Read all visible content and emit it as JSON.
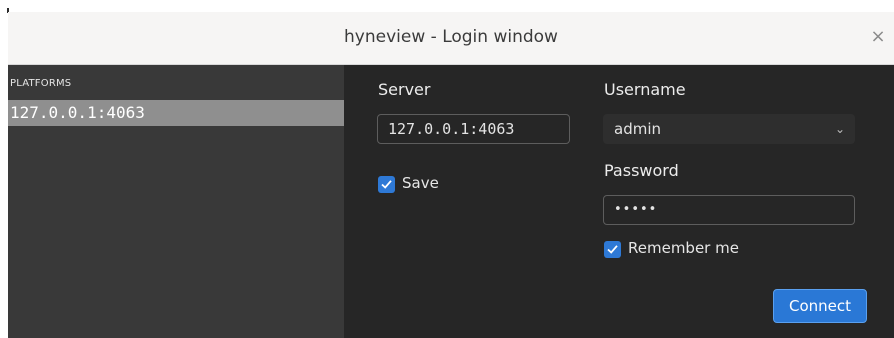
{
  "window": {
    "title": "hyneview - Login window",
    "close_glyph": "×"
  },
  "sidebar": {
    "header": "PLATFORMS",
    "items": [
      {
        "label": "127.0.0.1:4063",
        "selected": true
      }
    ]
  },
  "form": {
    "server_label": "Server",
    "server_value": "127.0.0.1:4063",
    "save_label": "Save",
    "save_checked": true,
    "username_label": "Username",
    "username_value": "admin",
    "password_label": "Password",
    "password_mask": "•••••",
    "remember_label": "Remember me",
    "remember_checked": true,
    "connect_label": "Connect"
  },
  "colors": {
    "accent": "#2a78d6",
    "sidebar_bg": "#393939",
    "main_bg": "#262626",
    "selected_bg": "#8f8f8f"
  },
  "icons": {
    "close": "close-icon",
    "dropdown": "chevron-down-icon",
    "check": "checkmark-icon"
  }
}
